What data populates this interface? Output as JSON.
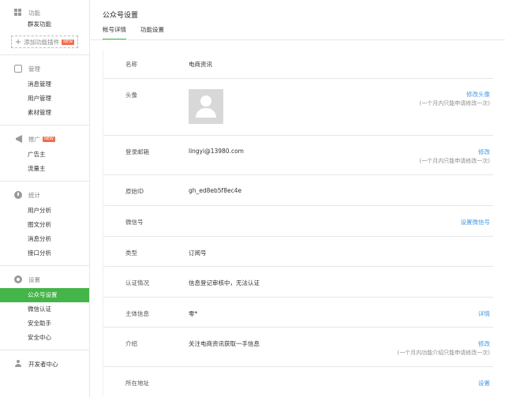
{
  "sidebar": {
    "sections": {
      "function": {
        "title": "功能",
        "items": [
          "群发功能"
        ]
      },
      "add_plugin": {
        "label": "添加功能插件",
        "badge": "NEW"
      },
      "management": {
        "title": "管理",
        "items": [
          "消息管理",
          "用户管理",
          "素材管理"
        ]
      },
      "promotion": {
        "title": "推广",
        "badge": "NEW",
        "items": [
          "广告主",
          "流量主"
        ]
      },
      "statistics": {
        "title": "统计",
        "items": [
          "用户分析",
          "图文分析",
          "消息分析",
          "接口分析"
        ]
      },
      "settings": {
        "title": "设置",
        "items": [
          "公众号设置",
          "微信认证",
          "安全助手",
          "安全中心"
        ]
      },
      "developer": {
        "title": "开发者中心"
      }
    },
    "active_item": "公众号设置"
  },
  "header": {
    "title": "公众号设置",
    "tabs": [
      "帐号详情",
      "功能设置"
    ],
    "active_tab": "帐号详情"
  },
  "details": {
    "name": {
      "label": "名称",
      "value": "电商资讯"
    },
    "avatar": {
      "label": "头像",
      "action": "修改头像",
      "hint": "(一个月内只能申请修改一次)"
    },
    "email": {
      "label": "登录邮箱",
      "value": "lingyi@13980.com",
      "action": "修改",
      "hint": "(一个月内只能申请修改一次)"
    },
    "original_id": {
      "label": "原始ID",
      "value": "gh_ed8eb5f8ec4e"
    },
    "wechat_id": {
      "label": "微信号",
      "action": "设置微信号"
    },
    "type": {
      "label": "类型",
      "value": "订阅号"
    },
    "verification": {
      "label": "认证情况",
      "value": "信息登记审核中，无法认证"
    },
    "entity": {
      "label": "主体信息",
      "value": "零*",
      "action": "详情"
    },
    "intro": {
      "label": "介绍",
      "value": "关注电商资讯获取一手信息",
      "action": "修改",
      "hint": "(一个月内功能介绍只能申请修改一次)"
    },
    "address": {
      "label": "所在地址",
      "action": "设置"
    }
  },
  "colors": {
    "accent": "#44b549",
    "link": "#459ae9",
    "badge": "#f06d4d"
  }
}
